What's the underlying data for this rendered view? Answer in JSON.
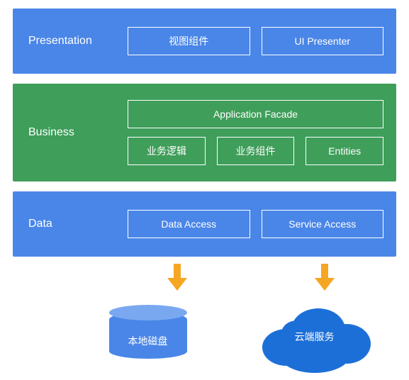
{
  "layers": {
    "presentation": {
      "label": "Presentation",
      "boxes": [
        "视图组件",
        "UI Presenter"
      ]
    },
    "business": {
      "label": "Business",
      "facade": "Application Facade",
      "boxes": [
        "业务逻辑",
        "业务组件",
        "Entities"
      ]
    },
    "data": {
      "label": "Data",
      "boxes": [
        "Data Access",
        "Service Access"
      ]
    }
  },
  "storage": {
    "disk": "本地磁盘",
    "cloud": "云端服务"
  },
  "colors": {
    "blue": "#4a86e8",
    "green": "#3f9e5a",
    "arrow": "#f5a623"
  }
}
